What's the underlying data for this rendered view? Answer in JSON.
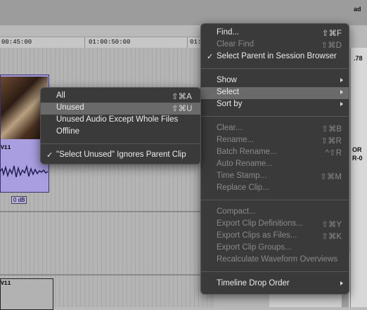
{
  "timeline": {
    "ruler_ticks": [
      "00:45:00",
      "01:00:50:00",
      "01:0"
    ],
    "clip_labels": [
      "V11",
      "V11"
    ],
    "volume_label": "0 dB",
    "right_panel_text": [
      "ad",
      ".78",
      "OR",
      "R-0"
    ]
  },
  "main_menu": {
    "items": [
      {
        "label": "Find...",
        "shortcut": "⇧⌘F",
        "disabled": false
      },
      {
        "label": "Clear Find",
        "shortcut": "⇧⌘D",
        "disabled": true
      },
      {
        "label": "Select Parent in Session Browser",
        "shortcut": "",
        "checked": true,
        "disabled": false
      },
      {
        "label": "Show",
        "submenu": true
      },
      {
        "label": "Select",
        "submenu": true,
        "highlighted": true
      },
      {
        "label": "Sort by",
        "submenu": true
      },
      {
        "label": "Clear...",
        "shortcut": "⇧⌘B",
        "disabled": true
      },
      {
        "label": "Rename...",
        "shortcut": "⇧⌘R",
        "disabled": true
      },
      {
        "label": "Batch Rename...",
        "shortcut": "^⇧R",
        "disabled": true
      },
      {
        "label": "Auto Rename...",
        "shortcut": "",
        "disabled": true
      },
      {
        "label": "Time Stamp...",
        "shortcut": "⇧⌘M",
        "disabled": true
      },
      {
        "label": "Replace Clip...",
        "shortcut": "",
        "disabled": true
      },
      {
        "label": "Compact...",
        "shortcut": "",
        "disabled": true
      },
      {
        "label": "Export Clip Definitions...",
        "shortcut": "⇧⌘Y",
        "disabled": true
      },
      {
        "label": "Export Clips as Files...",
        "shortcut": "⇧⌘K",
        "disabled": true
      },
      {
        "label": "Export Clip Groups...",
        "shortcut": "",
        "disabled": true
      },
      {
        "label": "Recalculate Waveform Overviews",
        "shortcut": "",
        "disabled": true
      },
      {
        "label": "Timeline Drop Order",
        "submenu": true
      }
    ]
  },
  "select_submenu": {
    "items": [
      {
        "label": "All",
        "shortcut": "⇧⌘A"
      },
      {
        "label": "Unused",
        "shortcut": "⇧⌘U",
        "highlighted": true
      },
      {
        "label": "Unused Audio Except Whole Files",
        "shortcut": ""
      },
      {
        "label": "Offline",
        "shortcut": ""
      },
      {
        "label": "\"Select Unused\" Ignores Parent Clip",
        "shortcut": "",
        "checked": true
      }
    ]
  },
  "colors": {
    "menu_bg": "#3a3a3a",
    "highlight": "#6a6a6a",
    "clip_purple": "#a89ee0"
  }
}
